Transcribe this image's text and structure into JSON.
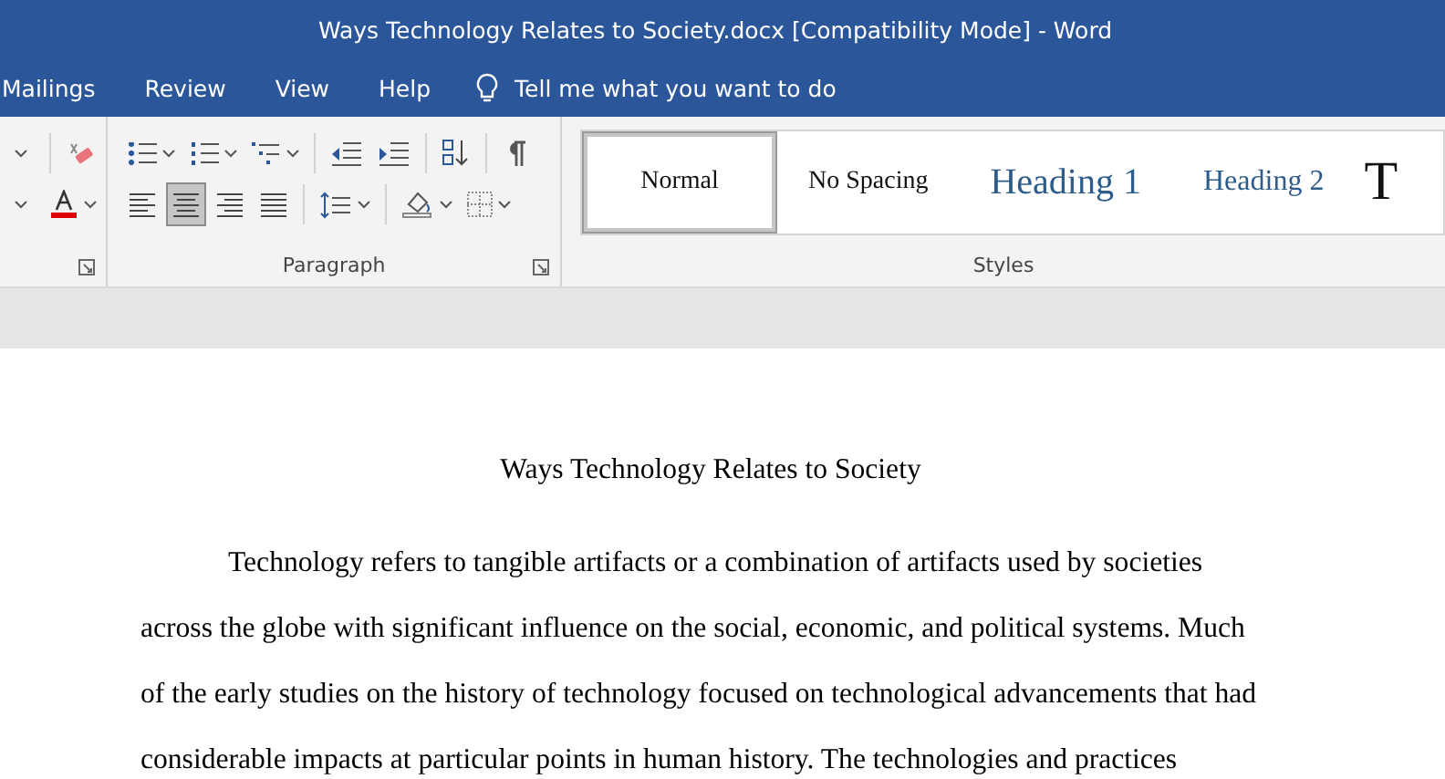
{
  "window": {
    "title": "Ways Technology Relates to Society.docx [Compatibility Mode]  -  Word"
  },
  "menu_tabs": [
    "Mailings",
    "Review",
    "View",
    "Help"
  ],
  "tell_me": {
    "placeholder": "Tell me what you want to do"
  },
  "ribbon": {
    "paragraph_group": {
      "label": "Paragraph",
      "alignment": [
        {
          "kind": "left",
          "selected": false
        },
        {
          "kind": "center",
          "selected": true
        },
        {
          "kind": "right",
          "selected": false
        },
        {
          "kind": "justify",
          "selected": false
        }
      ]
    },
    "styles_group": {
      "label": "Styles",
      "styles": [
        {
          "label": "Normal",
          "kind": "normal",
          "selected": true
        },
        {
          "label": "No Spacing",
          "kind": "plain",
          "selected": false
        },
        {
          "label": "Heading 1",
          "kind": "heading1",
          "selected": false
        },
        {
          "label": "Heading 2",
          "kind": "heading2",
          "selected": false
        },
        {
          "label": "T",
          "kind": "title",
          "selected": false
        }
      ]
    }
  },
  "document": {
    "title": "Ways Technology Relates to Society",
    "paragraphs": [
      "Technology refers to tangible artifacts or a combination of artifacts used by societies across the globe with significant influence on the social, economic, and political systems. Much of the early studies on the history of technology focused on technological advancements that had considerable impacts at particular points in human history. The technologies and practices"
    ]
  }
}
